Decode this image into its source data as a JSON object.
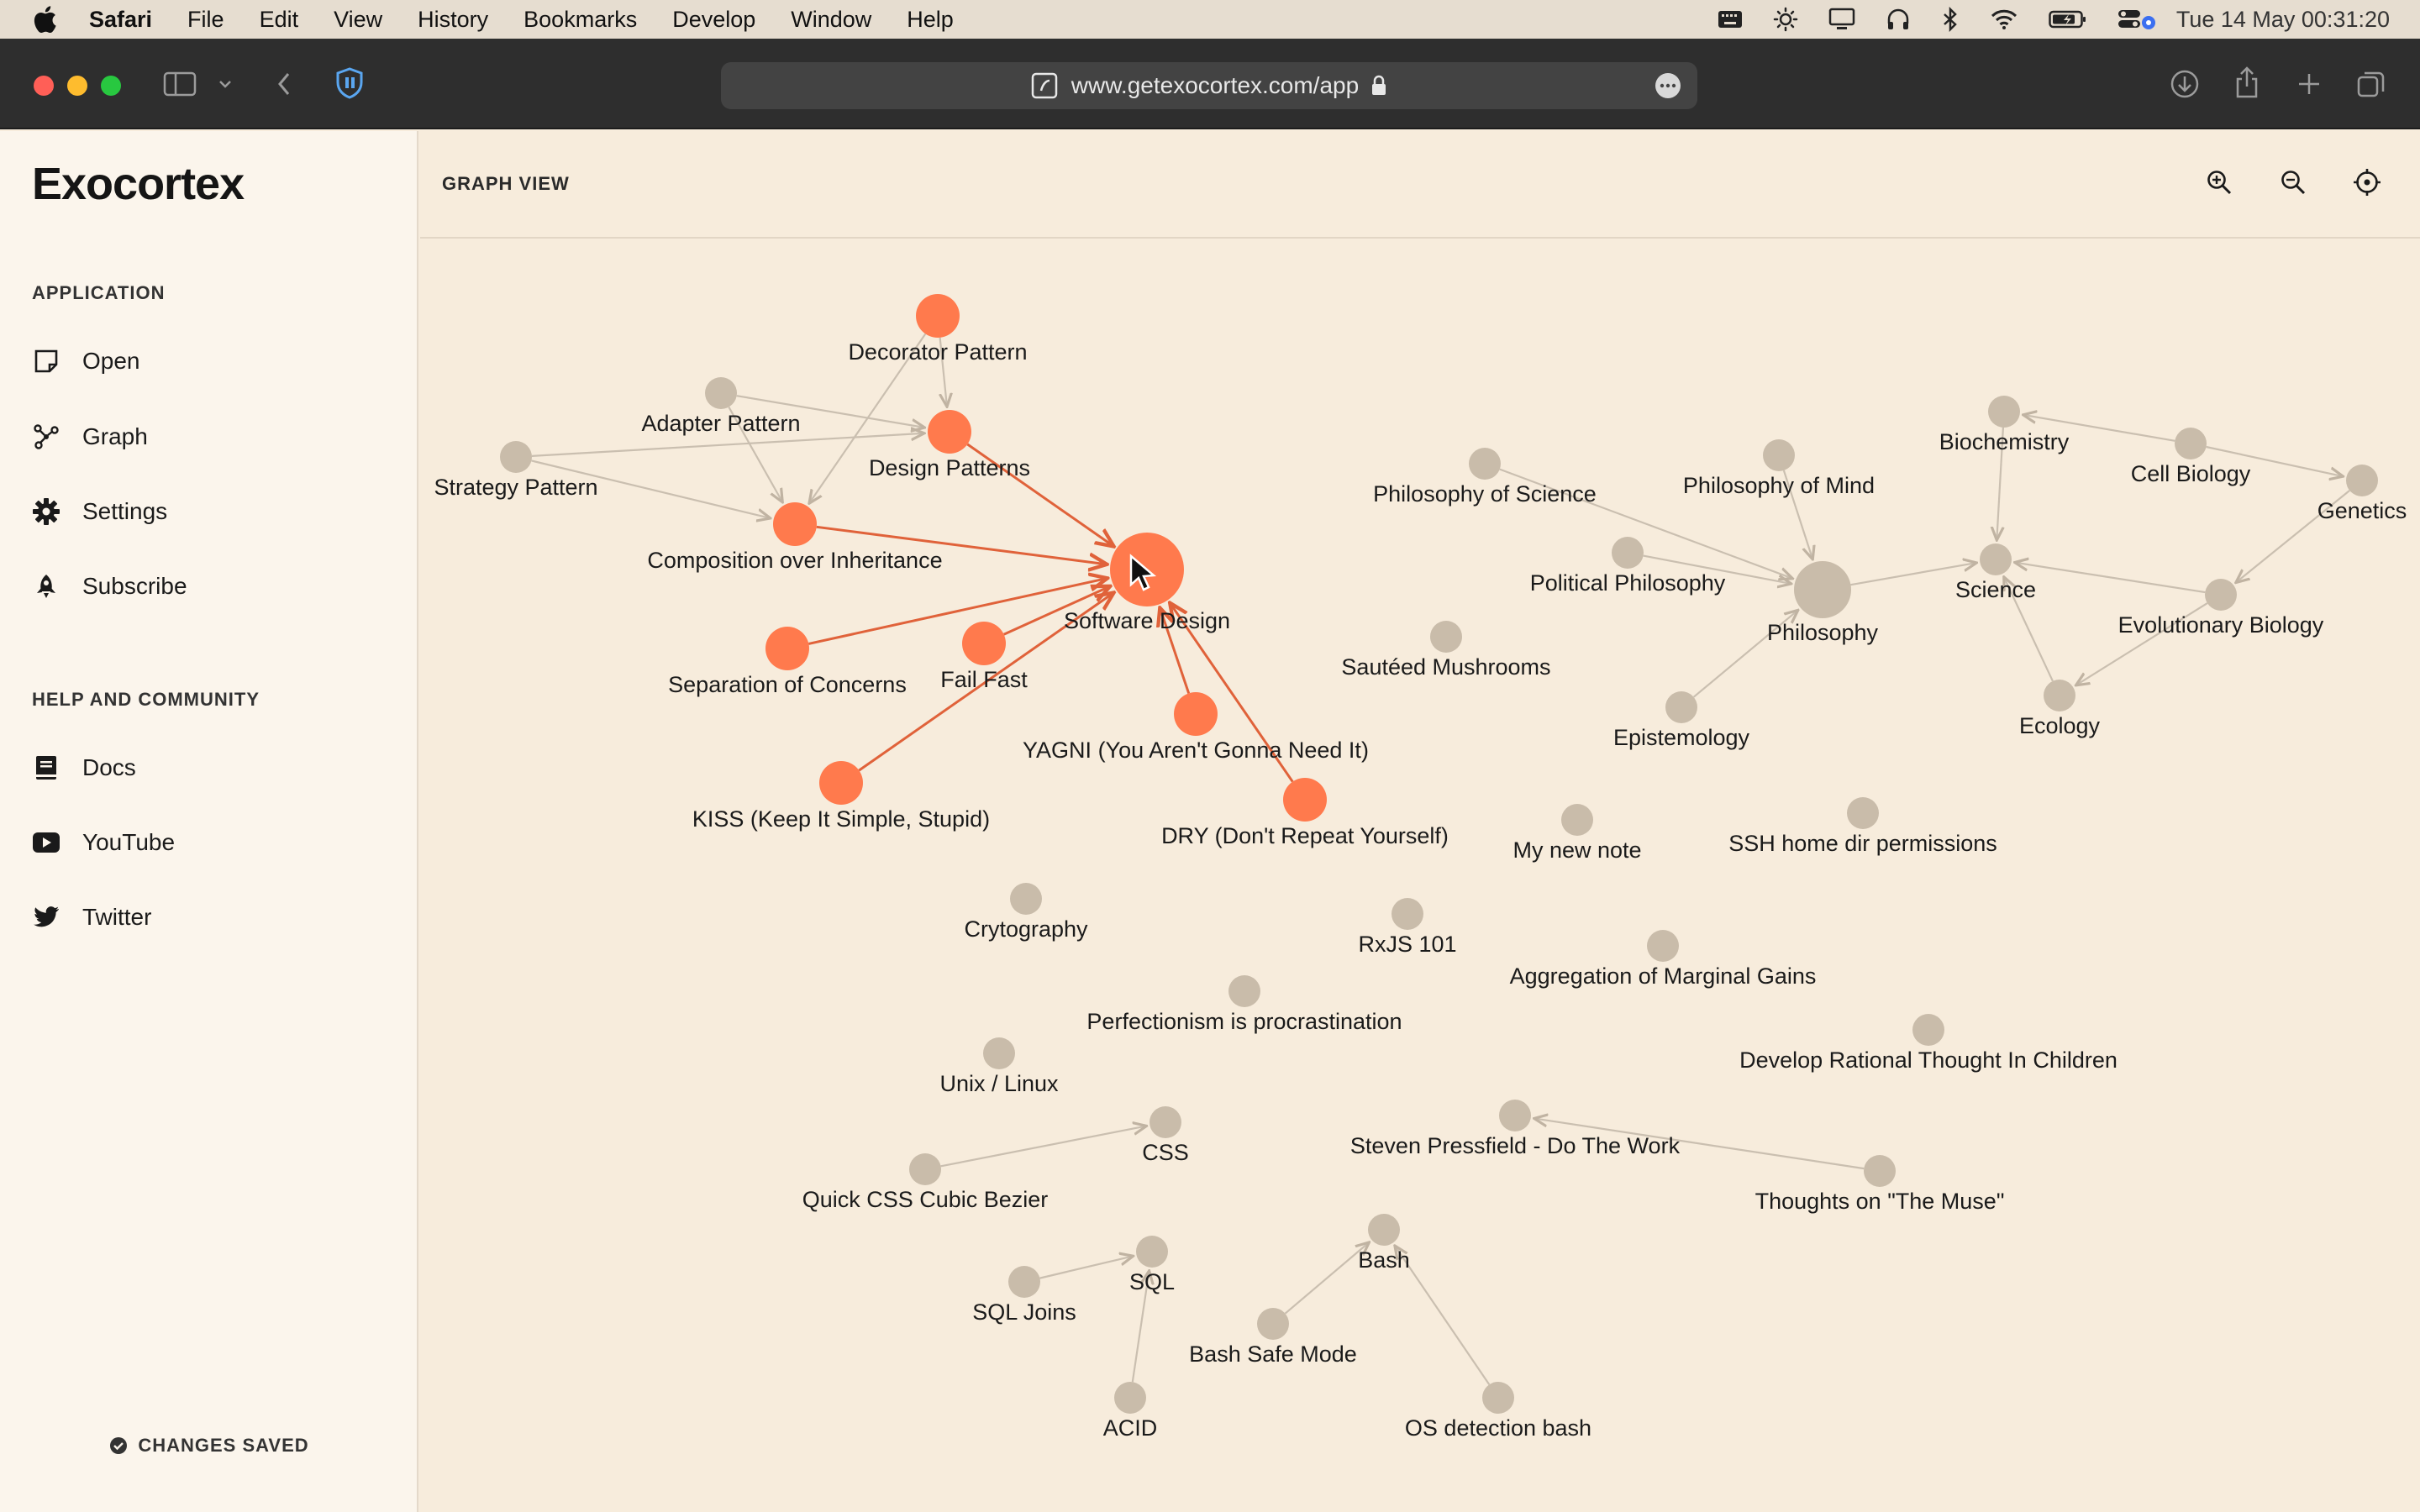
{
  "menubar": {
    "app_name": "Safari",
    "menus": [
      "File",
      "Edit",
      "View",
      "History",
      "Bookmarks",
      "Develop",
      "Window",
      "Help"
    ],
    "clock": "Tue 14 May  00:31:20",
    "status_icons": [
      "keyboard-icon",
      "brightness-icon",
      "display-icon",
      "headphones-icon",
      "bluetooth-icon",
      "wifi-icon",
      "battery-icon",
      "control-center-icon"
    ]
  },
  "browser": {
    "url": "www.getexocortex.com/app"
  },
  "sidebar": {
    "logo": "Exocortex",
    "application_title": "APPLICATION",
    "app_items": [
      {
        "label": "Open",
        "icon": "note-icon"
      },
      {
        "label": "Graph",
        "icon": "graph-icon"
      },
      {
        "label": "Settings",
        "icon": "gear-icon"
      },
      {
        "label": "Subscribe",
        "icon": "rocket-icon"
      }
    ],
    "community_title": "HELP AND COMMUNITY",
    "community_items": [
      {
        "label": "Docs",
        "icon": "book-icon"
      },
      {
        "label": "YouTube",
        "icon": "youtube-icon"
      },
      {
        "label": "Twitter",
        "icon": "twitter-icon"
      }
    ],
    "status": "CHANGES SAVED"
  },
  "graph": {
    "title": "GRAPH VIEW",
    "controls": [
      "zoom-in-icon",
      "zoom-out-icon",
      "recenter-icon"
    ],
    "colors": {
      "active": "#ff7a4d",
      "active_edge": "#e0623a",
      "inactive": "#c9bcaa",
      "inactive_edge": "#cabfb0",
      "label": "#1a1a1a"
    },
    "nodes": [
      {
        "id": "decorator",
        "label": "Decorator Pattern",
        "active": true,
        "hub": false
      },
      {
        "id": "adapter",
        "label": "Adapter Pattern",
        "active": false,
        "hub": false
      },
      {
        "id": "strategy",
        "label": "Strategy Pattern",
        "active": false,
        "hub": false
      },
      {
        "id": "designpatterns",
        "label": "Design Patterns",
        "active": true,
        "hub": false
      },
      {
        "id": "composition",
        "label": "Composition over Inheritance",
        "active": true,
        "hub": false
      },
      {
        "id": "software",
        "label": "Software Design",
        "active": true,
        "hub": true
      },
      {
        "id": "soc",
        "label": "Separation of Concerns",
        "active": true,
        "hub": false
      },
      {
        "id": "failfast",
        "label": "Fail Fast",
        "active": true,
        "hub": false
      },
      {
        "id": "yagni",
        "label": "YAGNI (You Aren't Gonna Need It)",
        "active": true,
        "hub": false
      },
      {
        "id": "kiss",
        "label": "KISS (Keep It Simple, Stupid)",
        "active": true,
        "hub": false
      },
      {
        "id": "dry",
        "label": "DRY (Don't Repeat Yourself)",
        "active": true,
        "hub": false
      },
      {
        "id": "philsci",
        "label": "Philosophy of Science",
        "active": false,
        "hub": false
      },
      {
        "id": "philmind",
        "label": "Philosophy of Mind",
        "active": false,
        "hub": false
      },
      {
        "id": "polphil",
        "label": "Political Philosophy",
        "active": false,
        "hub": false
      },
      {
        "id": "philosophy",
        "label": "Philosophy",
        "active": false,
        "hub": true
      },
      {
        "id": "epistemology",
        "label": "Epistemology",
        "active": false,
        "hub": false
      },
      {
        "id": "mushrooms",
        "label": "Sautéed Mushrooms",
        "active": false,
        "hub": false
      },
      {
        "id": "biochem",
        "label": "Biochemistry",
        "active": false,
        "hub": false
      },
      {
        "id": "cellbio",
        "label": "Cell Biology",
        "active": false,
        "hub": false
      },
      {
        "id": "genetics",
        "label": "Genetics",
        "active": false,
        "hub": false
      },
      {
        "id": "science",
        "label": "Science",
        "active": false,
        "hub": false
      },
      {
        "id": "evobio",
        "label": "Evolutionary Biology",
        "active": false,
        "hub": false
      },
      {
        "id": "ecology",
        "label": "Ecology",
        "active": false,
        "hub": false
      },
      {
        "id": "newnote",
        "label": "My new note",
        "active": false,
        "hub": false
      },
      {
        "id": "ssh",
        "label": "SSH home dir permissions",
        "active": false,
        "hub": false
      },
      {
        "id": "crypto",
        "label": "Crytography",
        "active": false,
        "hub": false
      },
      {
        "id": "rxjs",
        "label": "RxJS 101",
        "active": false,
        "hub": false
      },
      {
        "id": "marginal",
        "label": "Aggregation of Marginal Gains",
        "active": false,
        "hub": false
      },
      {
        "id": "perfection",
        "label": "Perfectionism is procrastination",
        "active": false,
        "hub": false
      },
      {
        "id": "rational",
        "label": "Develop Rational Thought In Children",
        "active": false,
        "hub": false
      },
      {
        "id": "unix",
        "label": "Unix / Linux",
        "active": false,
        "hub": false
      },
      {
        "id": "css",
        "label": "CSS",
        "active": false,
        "hub": false
      },
      {
        "id": "cubic",
        "label": "Quick CSS Cubic Bezier",
        "active": false,
        "hub": false
      },
      {
        "id": "pressfield",
        "label": "Steven Pressfield - Do The Work",
        "active": false,
        "hub": false
      },
      {
        "id": "muse",
        "label": "Thoughts on \"The Muse\"",
        "active": false,
        "hub": false
      },
      {
        "id": "sql",
        "label": "SQL",
        "active": false,
        "hub": false
      },
      {
        "id": "sqljoins",
        "label": "SQL Joins",
        "active": false,
        "hub": false
      },
      {
        "id": "acid",
        "label": "ACID",
        "active": false,
        "hub": false
      },
      {
        "id": "bash",
        "label": "Bash",
        "active": false,
        "hub": false
      },
      {
        "id": "bashsafe",
        "label": "Bash Safe Mode",
        "active": false,
        "hub": false
      },
      {
        "id": "osdetect",
        "label": "OS detection bash",
        "active": false,
        "hub": false
      }
    ],
    "edges": [
      [
        "decorator",
        "designpatterns"
      ],
      [
        "decorator",
        "composition"
      ],
      [
        "adapter",
        "designpatterns"
      ],
      [
        "adapter",
        "composition"
      ],
      [
        "strategy",
        "designpatterns"
      ],
      [
        "strategy",
        "composition"
      ],
      [
        "designpatterns",
        "software"
      ],
      [
        "composition",
        "software"
      ],
      [
        "soc",
        "software"
      ],
      [
        "failfast",
        "software"
      ],
      [
        "yagni",
        "software"
      ],
      [
        "kiss",
        "software"
      ],
      [
        "dry",
        "software"
      ],
      [
        "philsci",
        "philosophy"
      ],
      [
        "philmind",
        "philosophy"
      ],
      [
        "polphil",
        "philosophy"
      ],
      [
        "epistemology",
        "philosophy"
      ],
      [
        "philosophy",
        "science"
      ],
      [
        "biochem",
        "science"
      ],
      [
        "cellbio",
        "biochem"
      ],
      [
        "cellbio",
        "genetics"
      ],
      [
        "genetics",
        "evobio"
      ],
      [
        "evobio",
        "science"
      ],
      [
        "evobio",
        "ecology"
      ],
      [
        "ecology",
        "science"
      ],
      [
        "cubic",
        "css"
      ],
      [
        "muse",
        "pressfield"
      ],
      [
        "sqljoins",
        "sql"
      ],
      [
        "acid",
        "sql"
      ],
      [
        "bashsafe",
        "bash"
      ],
      [
        "osdetect",
        "bash"
      ]
    ]
  }
}
